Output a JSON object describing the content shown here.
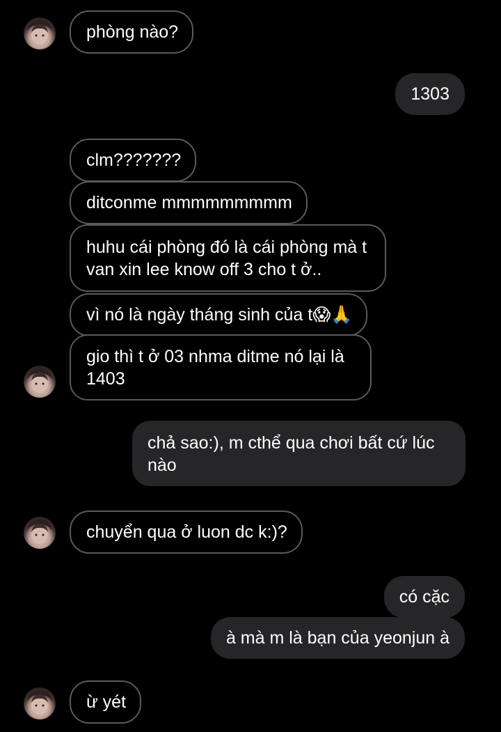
{
  "messages": [
    {
      "id": "m1",
      "from": "them",
      "text": "phòng nào?"
    },
    {
      "id": "m2",
      "from": "me",
      "text": "1303"
    },
    {
      "id": "m3",
      "from": "them",
      "text": "clm???????"
    },
    {
      "id": "m4",
      "from": "them",
      "text": "ditconme mmmmmmmmm"
    },
    {
      "id": "m5",
      "from": "them",
      "text": "huhu cái phòng đó là cái phòng mà t van xin lee know off 3 cho t ở.."
    },
    {
      "id": "m6",
      "from": "them",
      "text": "vì nó là ngày tháng sinh của t😱🙏"
    },
    {
      "id": "m7",
      "from": "them",
      "text": "gio thì t ở 03 nhma ditme nó lại là 1403"
    },
    {
      "id": "m8",
      "from": "me",
      "text": "chả sao:), m cthể qua chơi bất cứ lúc nào"
    },
    {
      "id": "m9",
      "from": "them",
      "text": "chuyển qua ở luon dc k:)?"
    },
    {
      "id": "m10",
      "from": "me",
      "text": "có cặc"
    },
    {
      "id": "m11",
      "from": "me",
      "text": "à mà m là bạn của yeonjun à"
    },
    {
      "id": "m12",
      "from": "them",
      "text": "ừ yét"
    }
  ],
  "colors": {
    "background": "#000000",
    "received_border": "#5a5a5a",
    "sent_bubble": "#262628",
    "text": "#ffffff"
  },
  "icons": {
    "avatar": "contact-avatar-photo"
  }
}
